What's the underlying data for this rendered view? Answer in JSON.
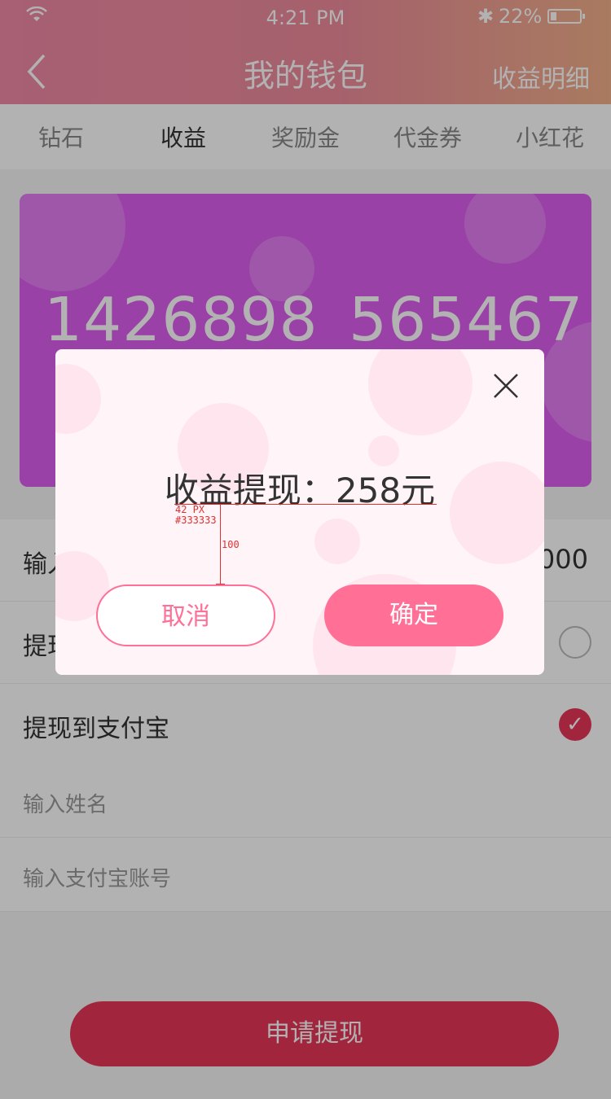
{
  "status_bar": {
    "time": "4:21 PM",
    "battery": "22%",
    "battery_level": 0.22
  },
  "nav": {
    "title": "我的钱包",
    "right_link": "收益明细"
  },
  "tabs": [
    "钻石",
    "收益",
    "奖励金",
    "代金券",
    "小红花"
  ],
  "active_tab": 1,
  "card": {
    "value_left": "1426898",
    "value_right": "565467"
  },
  "form": {
    "amount_label": "输入",
    "amount_value": "0000",
    "option_bank_label": "提现",
    "option_alipay_label": "提现到支付宝",
    "name_placeholder": "输入姓名",
    "account_placeholder": "输入支付宝账号"
  },
  "apply_button": "申请提现",
  "dialog": {
    "title": "收益提现：258元",
    "cancel": "取消",
    "confirm": "确定"
  },
  "annotation": {
    "size": "42 PX",
    "color": "#333333",
    "spacing": "100"
  },
  "colors": {
    "accent": "#e8355a",
    "dialog_button": "#ff6f96",
    "card": "#dd5df0"
  }
}
